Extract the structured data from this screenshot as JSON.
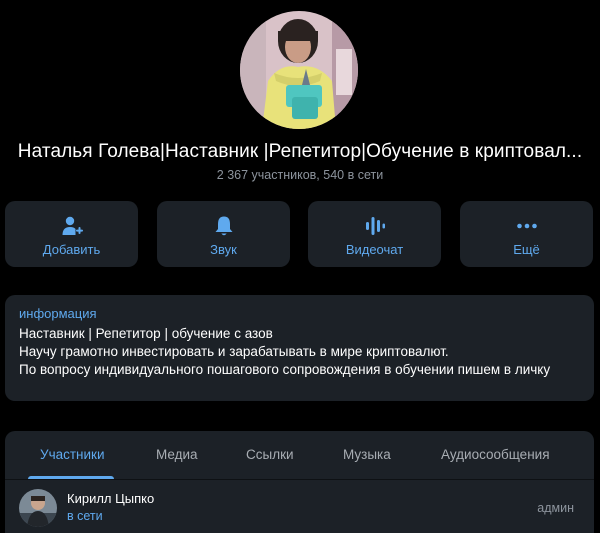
{
  "profile": {
    "title": "Наталья Голева|Наставник |Репетитор|Обучение в криптовал...",
    "subtitle": "2 367 участников, 540 в сети"
  },
  "actions": [
    {
      "label": "Добавить",
      "icon": "add-user-icon"
    },
    {
      "label": "Звук",
      "icon": "bell-icon"
    },
    {
      "label": "Видеочат",
      "icon": "voice-chat-icon"
    },
    {
      "label": "Ещё",
      "icon": "more-icon"
    }
  ],
  "info": {
    "label": "информация",
    "lines": [
      "Наставник | Репетитор | обучение с азов",
      "Научу грамотно инвестировать и зарабатывать в мире криптовалют.",
      "По вопросу индивидуального пошагового сопровождения в обучении пишем в личку"
    ]
  },
  "tabs": [
    {
      "label": "Участники",
      "active": true
    },
    {
      "label": "Медиа",
      "active": false
    },
    {
      "label": "Ссылки",
      "active": false
    },
    {
      "label": "Музыка",
      "active": false
    },
    {
      "label": "Аудиосообщения",
      "active": false
    }
  ],
  "members": [
    {
      "name": "Кирилл Цыпко",
      "status": "в сети",
      "role": "админ"
    }
  ],
  "colors": {
    "background": "#000000",
    "card": "#1c2127",
    "accent": "#5fa9ee",
    "muted": "#8d949d"
  }
}
